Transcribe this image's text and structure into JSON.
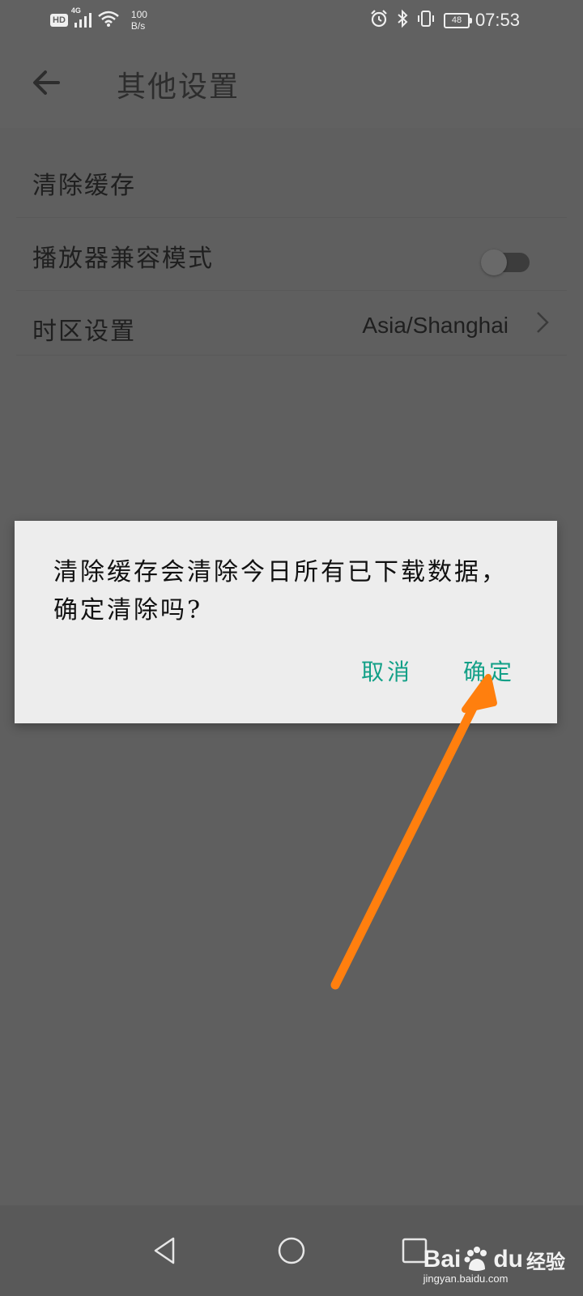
{
  "status_bar": {
    "hd": "HD",
    "network": "4G",
    "speed_value": "100",
    "speed_unit": "B/s",
    "battery": "48",
    "time": "07:53"
  },
  "app_bar": {
    "title": "其他设置"
  },
  "settings": {
    "clear_cache": "清除缓存",
    "player_compat": "播放器兼容模式",
    "player_compat_enabled": false,
    "timezone_label": "时区设置",
    "timezone_value": "Asia/Shanghai"
  },
  "dialog": {
    "message": "清除缓存会清除今日所有已下载数据，确定清除吗?",
    "cancel": "取消",
    "confirm": "确定"
  },
  "watermark": {
    "logo_bai": "Bai",
    "logo_du": "du",
    "logo_jingyan": "经验",
    "url": "jingyan.baidu.com"
  },
  "colors": {
    "dialog_button": "#12a087",
    "annotation_arrow": "#ff7f0e"
  }
}
